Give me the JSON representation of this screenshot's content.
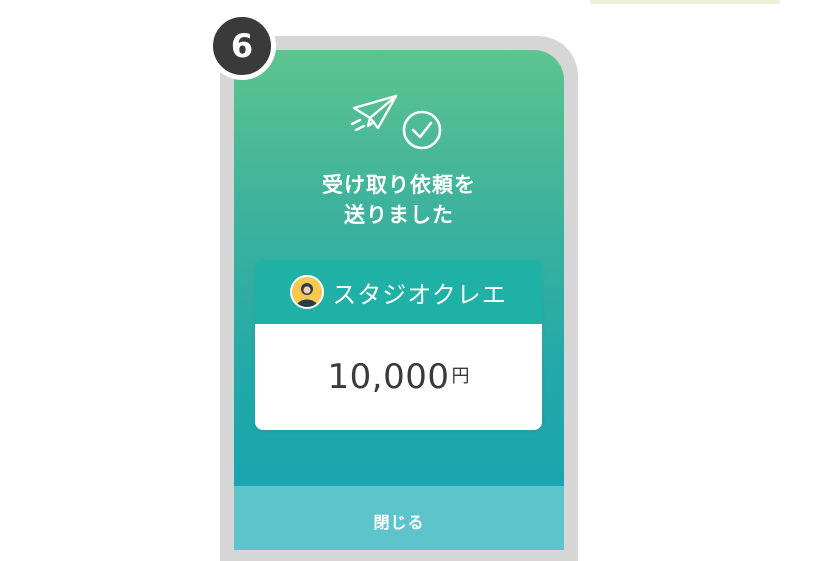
{
  "step": {
    "number": "6"
  },
  "dialog": {
    "message_line1": "受け取り依頼を",
    "message_line2": "送りました",
    "illustration_icons": [
      "paper-plane-icon",
      "check-circle-icon"
    ]
  },
  "recipient": {
    "name": "スタジオクレエ",
    "avatar_icon": "person-avatar-icon"
  },
  "amount": {
    "value": "10,000",
    "currency": "円"
  },
  "footer": {
    "close_label": "閉じる"
  },
  "colors": {
    "gradient_top": "#5dc48f",
    "gradient_bottom": "#16a3b3",
    "card_header": "#1fb1a6",
    "close_bar": "#5ec4cb",
    "badge": "#3a3a3a"
  }
}
